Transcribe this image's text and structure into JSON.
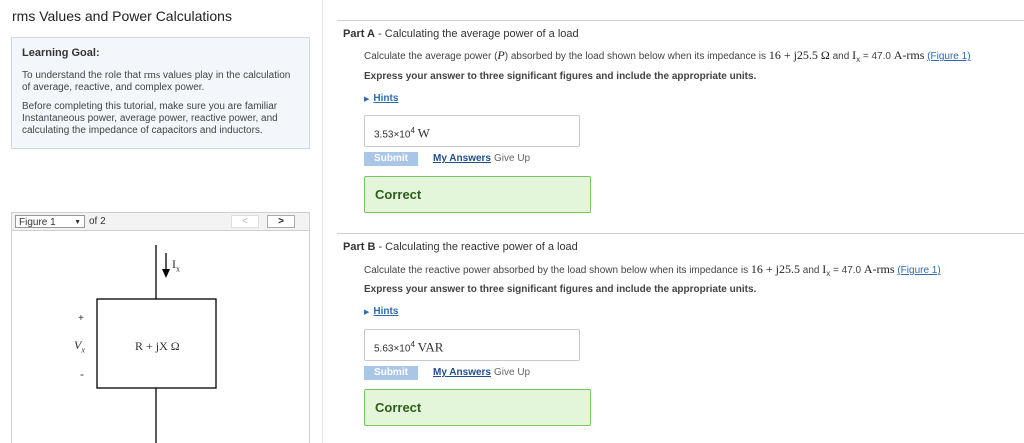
{
  "page": {
    "title": "rms Values and Power Calculations"
  },
  "learning_goal": {
    "heading": "Learning Goal:",
    "p1_pre": "To understand the role that ",
    "p1_rms": "rms",
    "p1_line1_post": " values play in the calculation",
    "p1_line2": "of average, reactive, and complex power.",
    "p2_line1": "Before completing this tutorial, make sure you are familiar",
    "p2_line2": "Instantaneous power, average power, reactive power, and",
    "p2_line3": "calculating the impedance of capacitors and inductors."
  },
  "figure": {
    "selected": "Figure 1",
    "of": "of 2",
    "prev": "<",
    "next": ">",
    "current_label": "I",
    "current_sub": "x",
    "plus": "+",
    "minus": "-",
    "voltage_label": "V",
    "voltage_sub": "x",
    "impedance_label": "R + jX Ω"
  },
  "part_a": {
    "label": "Part A",
    "title": " - Calculating the average power of a load",
    "instr_pre": "Calculate the average power (",
    "instr_P": "P",
    "instr_mid": ") absorbed by the load shown below when its impedance is ",
    "instr_z": "16 + j25.5 Ω",
    "instr_and": " and ",
    "instr_I": "I",
    "instr_Isub": "x",
    "instr_eq": " = 47.0 ",
    "instr_unit": "A-rms",
    "instr_link": "(Figure 1)",
    "express": "Express your answer to three significant figures and include the appropriate units.",
    "hints": "Hints",
    "answer_value": "3.53×10",
    "answer_exp": "4",
    "answer_unit": "W",
    "submit": "Submit",
    "my_answers": "My Answers",
    "give_up": "Give Up",
    "result": "Correct"
  },
  "part_b": {
    "label": "Part B",
    "title": " - Calculating the reactive power of a load",
    "instr_pre": "Calculate the reactive power absorbed by the load shown below when its impedance is ",
    "instr_z": "16 + j25.5",
    "instr_and": " and ",
    "instr_I": "I",
    "instr_Isub": "x",
    "instr_eq": " = 47.0 ",
    "instr_unit": "A-rms",
    "instr_link": "(Figure 1)",
    "express": "Express your answer to three significant figures and include the appropriate units.",
    "hints": "Hints",
    "answer_value": "5.63×10",
    "answer_exp": "4",
    "answer_unit": "VAR",
    "submit": "Submit",
    "my_answers": "My Answers",
    "give_up": "Give Up",
    "result": "Correct"
  }
}
